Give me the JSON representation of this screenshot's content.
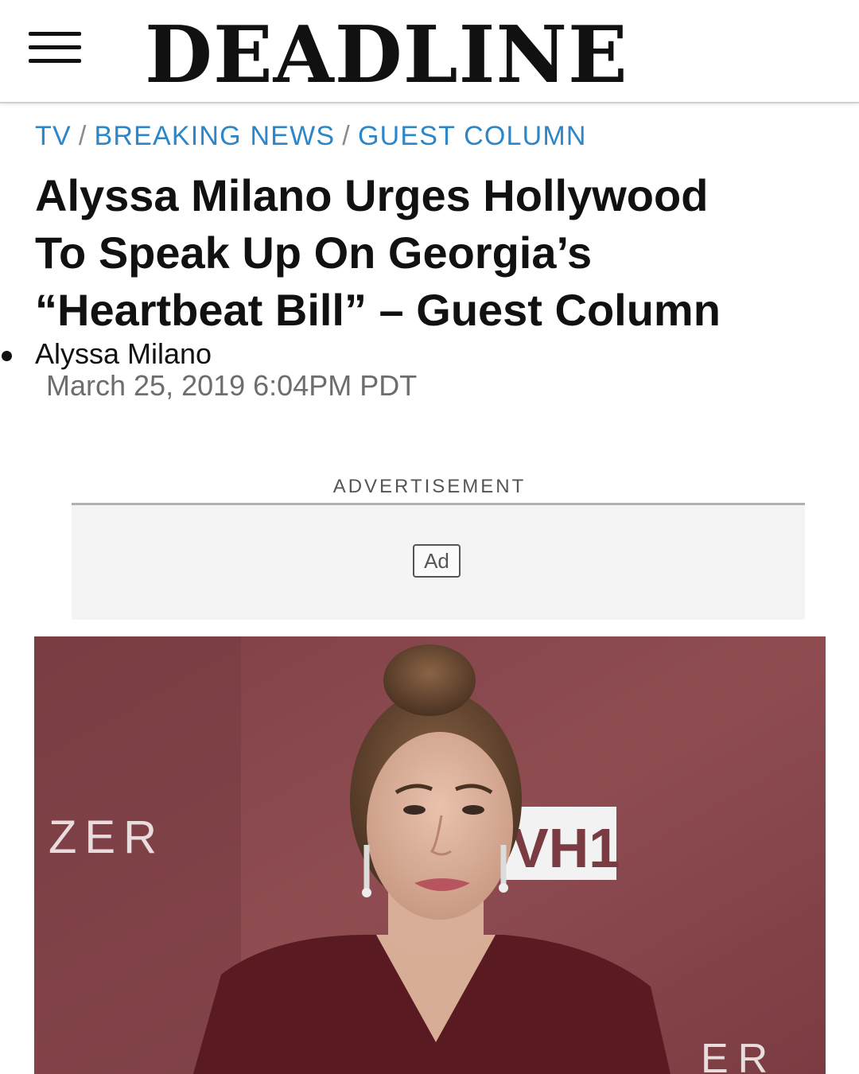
{
  "header": {
    "logo_text": "DEADLINE"
  },
  "breadcrumb": {
    "items": [
      "TV",
      "BREAKING NEWS",
      "GUEST COLUMN"
    ],
    "separator": "/"
  },
  "article": {
    "title_lines": [
      "Alyssa Milano Urges Hollywood",
      "To Speak Up On Georgia’s",
      "“Heartbeat Bill” – Guest Column"
    ],
    "author": "Alyssa Milano",
    "date": "March 25, 2019 6:04PM PDT"
  },
  "ad": {
    "label": "ADVERTISEMENT",
    "badge": "Ad"
  },
  "photo": {
    "backdrop_text_left": "ZER",
    "backdrop_logo": "VH1",
    "backdrop_text_bottom": "ER"
  },
  "colors": {
    "link_blue": "#2c86c7",
    "backdrop": "#8c4a4e",
    "jacket": "#5a1a22"
  }
}
